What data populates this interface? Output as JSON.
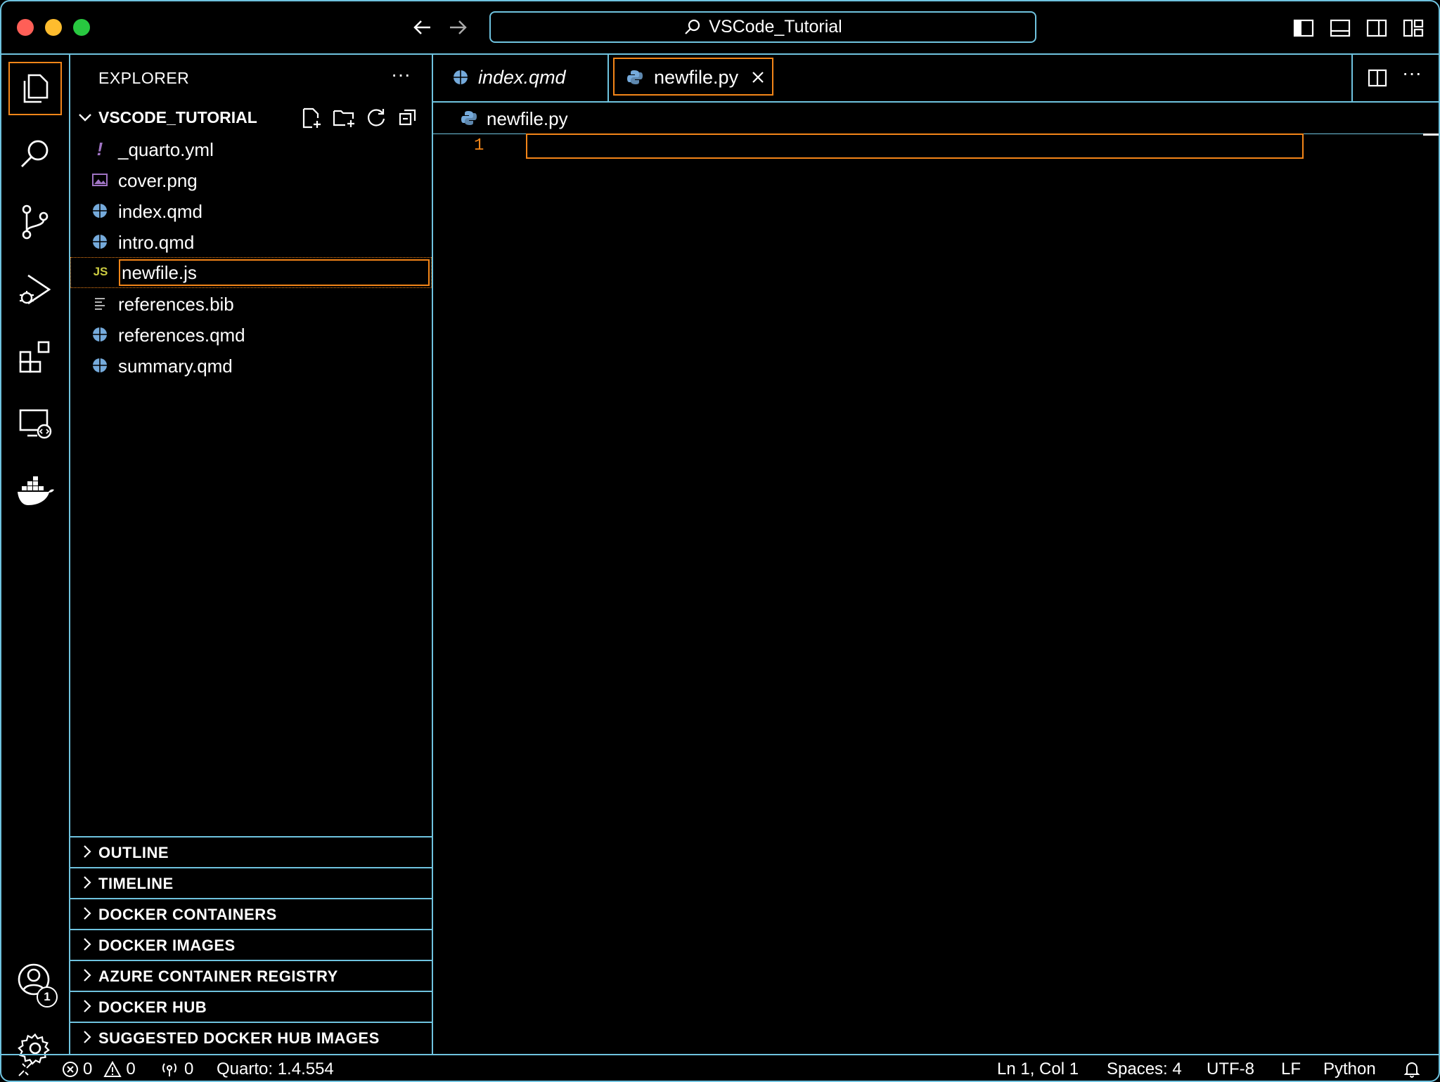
{
  "titlebar": {
    "search_text": "VSCode_Tutorial"
  },
  "sidebar": {
    "title": "EXPLORER",
    "more": "···",
    "folder": "VSCODE_TUTORIAL",
    "files": [
      {
        "name": "_quarto.yml",
        "icon": "yaml-exclamation-icon"
      },
      {
        "name": "cover.png",
        "icon": "image-icon"
      },
      {
        "name": "index.qmd",
        "icon": "quarto-icon"
      },
      {
        "name": "intro.qmd",
        "icon": "quarto-icon"
      }
    ],
    "rename_value": "newfile.js",
    "rename_icon_text": "JS",
    "files_after": [
      {
        "name": "references.bib",
        "icon": "lines-icon"
      },
      {
        "name": "references.qmd",
        "icon": "quarto-icon"
      },
      {
        "name": "summary.qmd",
        "icon": "quarto-icon"
      }
    ],
    "panels": [
      "OUTLINE",
      "TIMELINE",
      "DOCKER CONTAINERS",
      "DOCKER IMAGES",
      "AZURE CONTAINER REGISTRY",
      "DOCKER HUB",
      "SUGGESTED DOCKER HUB IMAGES"
    ]
  },
  "editor": {
    "tabs": [
      {
        "label": "index.qmd",
        "icon": "quarto-icon",
        "active": false
      },
      {
        "label": "newfile.py",
        "icon": "python-icon",
        "active": true
      }
    ],
    "breadcrumb": "newfile.py",
    "line_number": "1"
  },
  "account_badge": "1",
  "statusbar": {
    "errors": "0",
    "warnings": "0",
    "ports": "0",
    "quarto": "Quarto: 1.4.554",
    "position": "Ln 1, Col 1",
    "spaces": "Spaces: 4",
    "encoding": "UTF-8",
    "eol": "LF",
    "language": "Python"
  },
  "colors": {
    "border": "#6fc3df",
    "focus": "#f38518",
    "quarto": "#75aadb",
    "js": "#cbcb41"
  }
}
